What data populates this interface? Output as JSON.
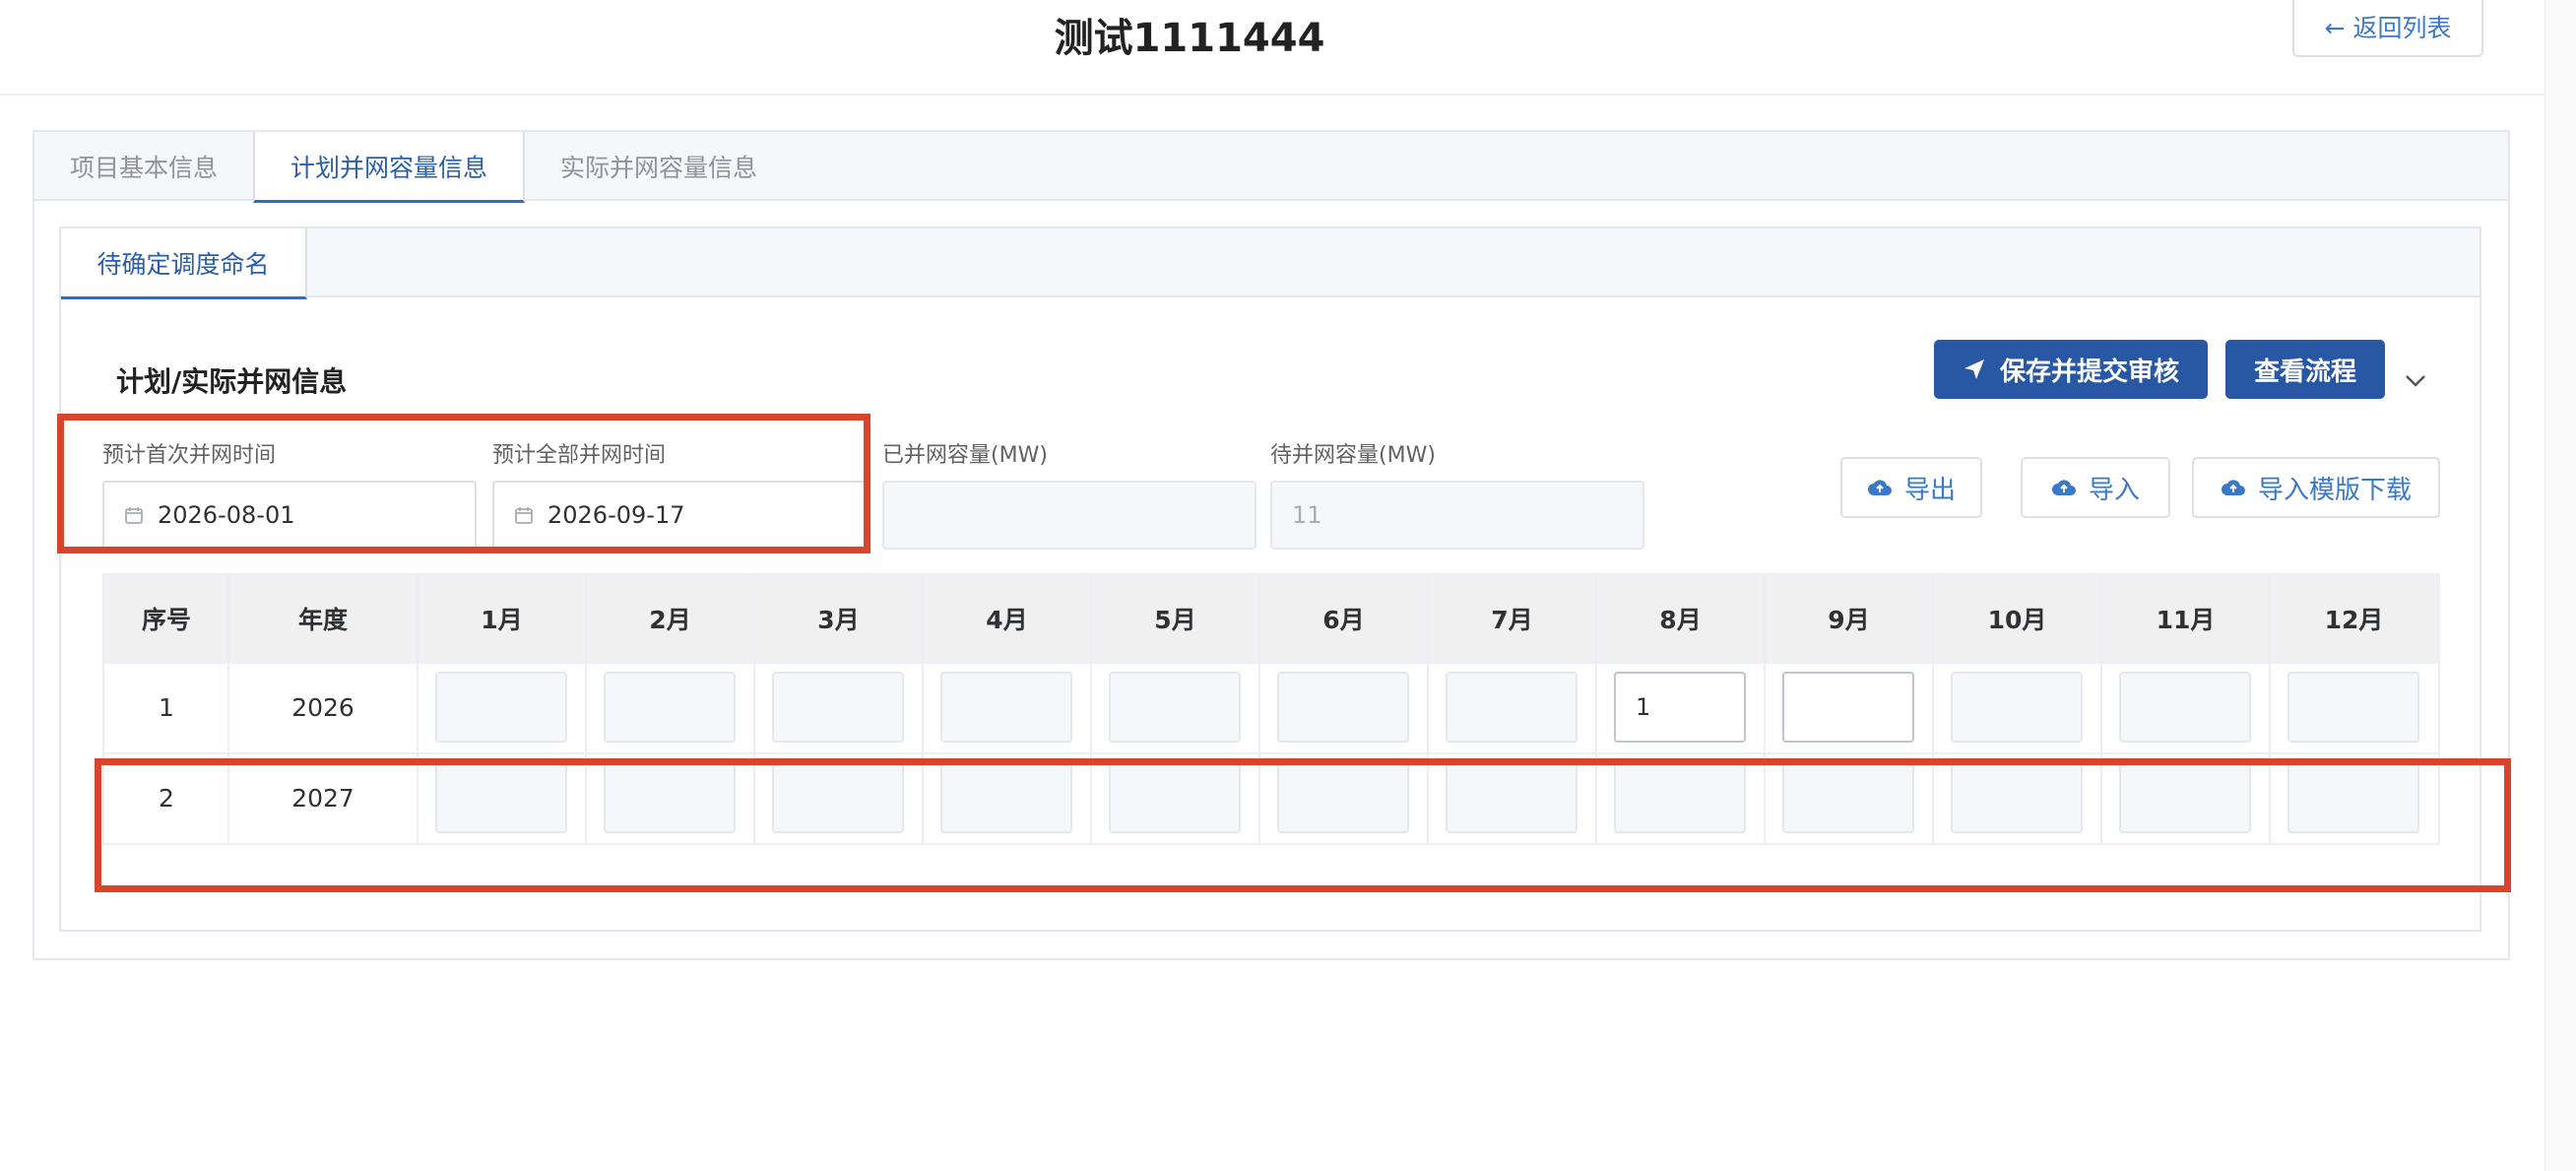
{
  "header": {
    "title": "测试1111444",
    "back_label": "← 返回列表"
  },
  "tabs": [
    {
      "label": "项目基本信息",
      "active": false
    },
    {
      "label": "计划并网容量信息",
      "active": true
    },
    {
      "label": "实际并网容量信息",
      "active": false
    }
  ],
  "subtab": {
    "label": "待确定调度命名"
  },
  "section": {
    "title": "计划/实际并网信息"
  },
  "actions": {
    "submit_label": "保存并提交审核",
    "flow_label": "查看流程",
    "export_label": "导出",
    "import_label": "导入",
    "template_label": "导入模版下载"
  },
  "fields": {
    "first_label": "预计首次并网时间",
    "first_value": "2026-08-01",
    "all_label": "预计全部并网时间",
    "all_value": "2026-09-17",
    "connected_label": "已并网容量(MW)",
    "connected_value": "",
    "pending_label": "待并网容量(MW)",
    "pending_value": "11"
  },
  "table": {
    "headers": [
      "序号",
      "年度",
      "1月",
      "2月",
      "3月",
      "4月",
      "5月",
      "6月",
      "7月",
      "8月",
      "9月",
      "10月",
      "11月",
      "12月"
    ],
    "rows": [
      {
        "index": "1",
        "year": "2026",
        "months": [
          "",
          "",
          "",
          "",
          "",
          "",
          "",
          "1",
          "",
          "",
          "",
          ""
        ]
      },
      {
        "index": "2",
        "year": "2027",
        "months": [
          "",
          "",
          "",
          "",
          "",
          "",
          "",
          "",
          "",
          "",
          "",
          ""
        ]
      }
    ]
  },
  "colors": {
    "primary": "#2857a4",
    "accent": "#2a6ecb",
    "highlight": "#d9452c"
  }
}
